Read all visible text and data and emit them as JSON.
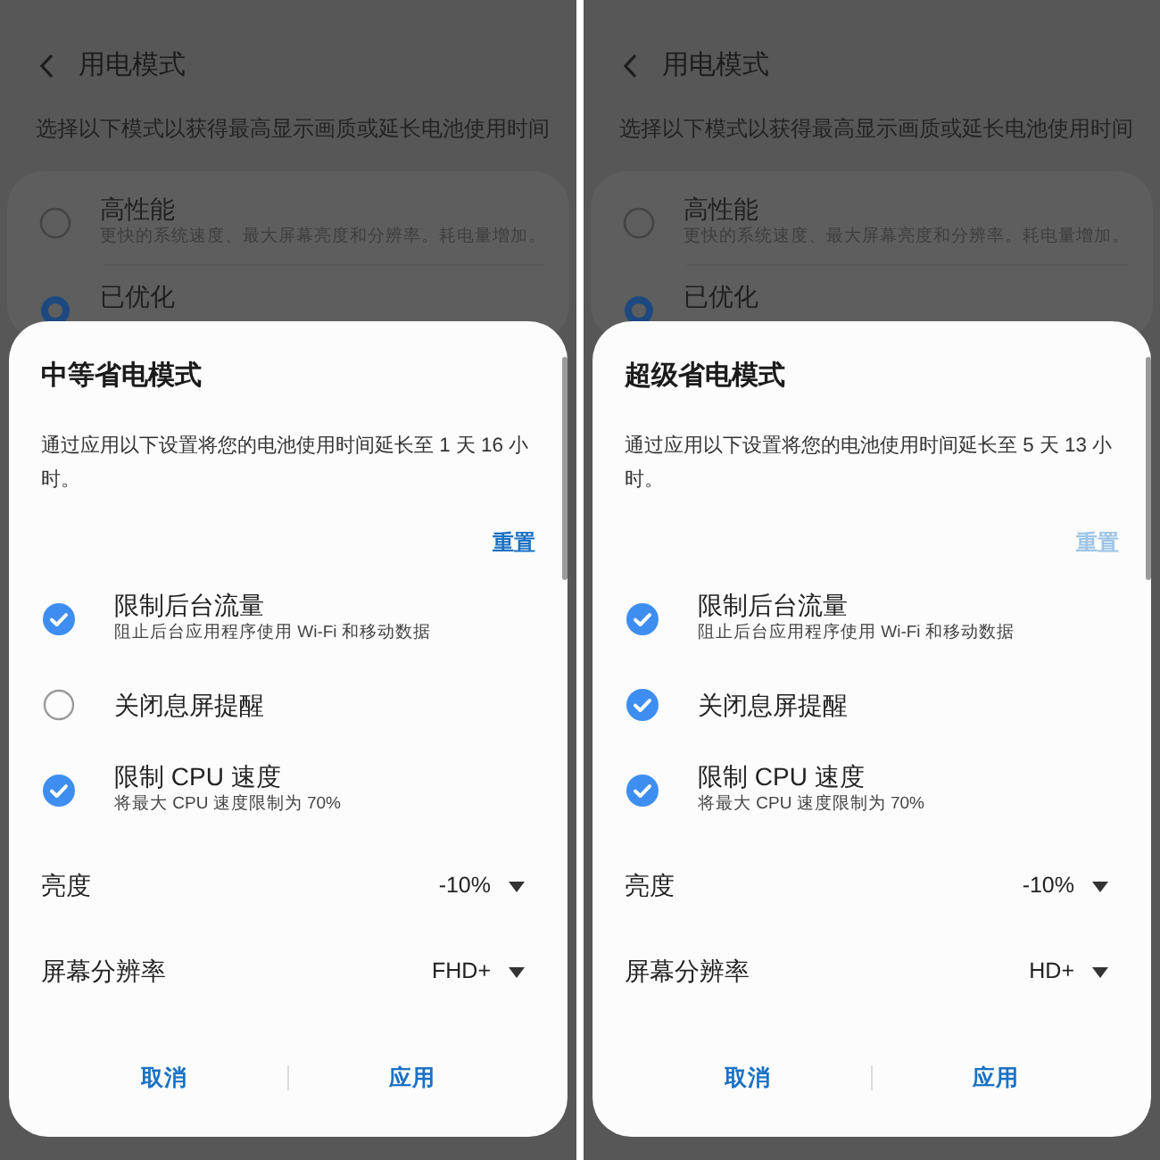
{
  "panels": [
    {
      "header": {
        "title": "用电模式"
      },
      "subtitle": "选择以下模式以获得最高显示画质或延长电池使用时间",
      "modes": [
        {
          "title": "高性能",
          "desc": "更快的系统速度、最大屏幕亮度和分辨率。耗电量增加。",
          "selected": false
        },
        {
          "title": "已优化",
          "selected": true
        }
      ],
      "dialog": {
        "title": "中等省电模式",
        "text": "通过应用以下设置将您的电池使用时间延长至 1 天 16 小时。",
        "reset": {
          "label": "重置",
          "disabled": false
        },
        "options": [
          {
            "title": "限制后台流量",
            "desc": "阻止后台应用程序使用 Wi-Fi 和移动数据",
            "checked": true
          },
          {
            "title": "关闭息屏提醒",
            "checked": false
          },
          {
            "title": "限制 CPU 速度",
            "desc": "将最大 CPU 速度限制为 70%",
            "checked": true
          }
        ],
        "settings": [
          {
            "label": "亮度",
            "value": "-10%"
          },
          {
            "label": "屏幕分辨率",
            "value": "FHD+"
          }
        ],
        "buttons": [
          "取消",
          "应用"
        ]
      }
    },
    {
      "header": {
        "title": "用电模式"
      },
      "subtitle": "选择以下模式以获得最高显示画质或延长电池使用时间",
      "modes": [
        {
          "title": "高性能",
          "desc": "更快的系统速度、最大屏幕亮度和分辨率。耗电量增加。",
          "selected": false
        },
        {
          "title": "已优化",
          "selected": true
        }
      ],
      "dialog": {
        "title": "超级省电模式",
        "text": "通过应用以下设置将您的电池使用时间延长至 5 天 13 小时。",
        "reset": {
          "label": "重置",
          "disabled": true
        },
        "options": [
          {
            "title": "限制后台流量",
            "desc": "阻止后台应用程序使用 Wi-Fi 和移动数据",
            "checked": true
          },
          {
            "title": "关闭息屏提醒",
            "checked": true
          },
          {
            "title": "限制 CPU 速度",
            "desc": "将最大 CPU 速度限制为 70%",
            "checked": true
          }
        ],
        "settings": [
          {
            "label": "亮度",
            "value": "-10%"
          },
          {
            "label": "屏幕分辨率",
            "value": "HD+"
          }
        ],
        "buttons": [
          "取消",
          "应用"
        ]
      }
    }
  ]
}
